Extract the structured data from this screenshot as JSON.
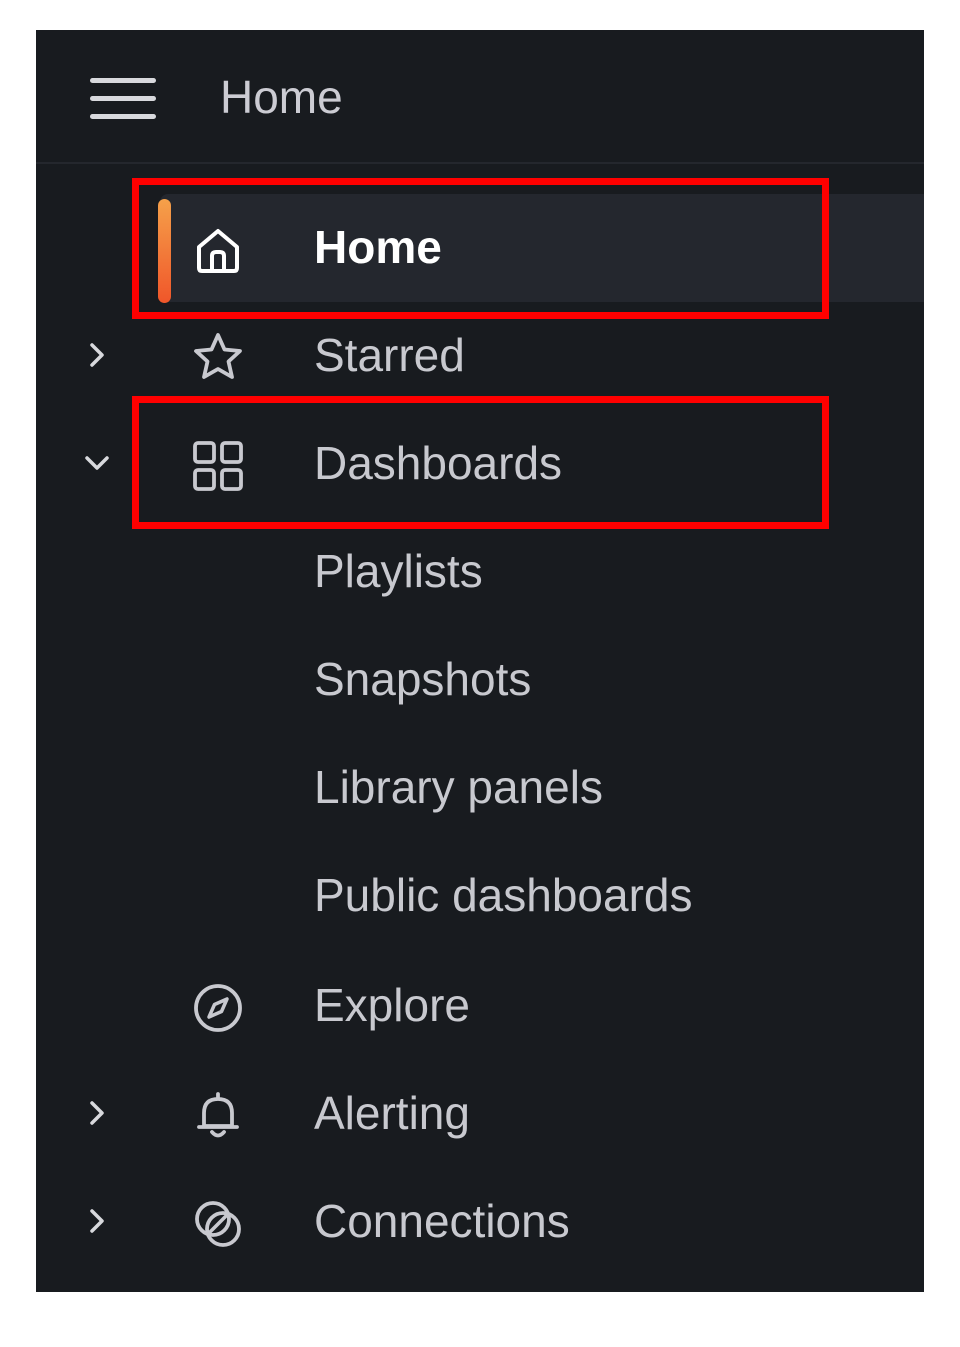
{
  "header": {
    "title": "Home",
    "menu_icon": "hamburger-menu-icon"
  },
  "nav": {
    "items": [
      {
        "label": "Home",
        "icon": "home-icon",
        "active": true,
        "expander": "none"
      },
      {
        "label": "Starred",
        "icon": "star-icon",
        "active": false,
        "expander": "collapsed"
      },
      {
        "label": "Dashboards",
        "icon": "dashboards-grid-icon",
        "active": false,
        "expander": "expanded",
        "children": [
          {
            "label": "Playlists"
          },
          {
            "label": "Snapshots"
          },
          {
            "label": "Library panels"
          },
          {
            "label": "Public dashboards"
          }
        ]
      },
      {
        "label": "Explore",
        "icon": "compass-icon",
        "active": false,
        "expander": "none"
      },
      {
        "label": "Alerting",
        "icon": "bell-icon",
        "active": false,
        "expander": "collapsed"
      },
      {
        "label": "Connections",
        "icon": "connections-icon",
        "active": false,
        "expander": "collapsed"
      }
    ]
  },
  "colors": {
    "panel_background": "#181b1f",
    "active_background": "#24272e",
    "active_accent": "#f0562a",
    "highlight_box": "#ff0000",
    "text": "#c8c9cf"
  }
}
